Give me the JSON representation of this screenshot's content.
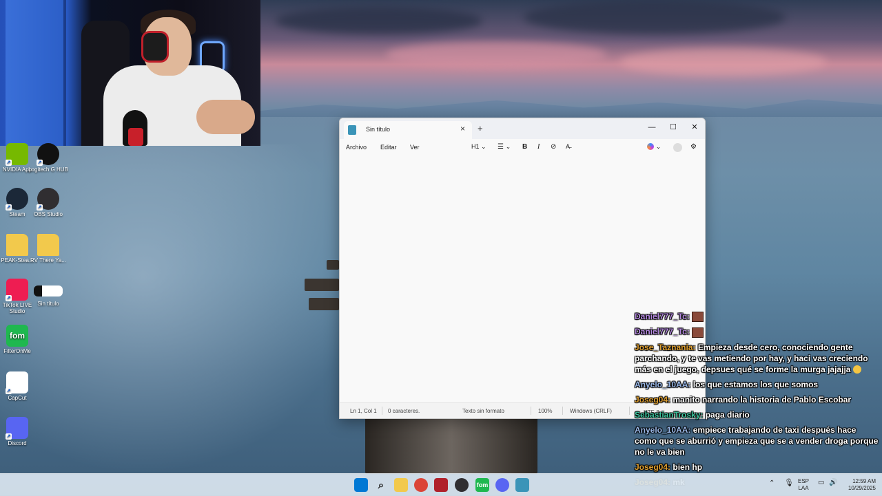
{
  "desktop": {
    "icons": [
      {
        "label": "NVIDIA App",
        "icon": "nvidia-icon",
        "color": "#76b900"
      },
      {
        "label": "Logitech G HUB",
        "icon": "logitech-g-icon",
        "color": "#111111"
      },
      {
        "label": "Steam",
        "icon": "steam-icon",
        "color": "#1b2838"
      },
      {
        "label": "OBS Studio",
        "icon": "obs-icon",
        "color": "#302e31"
      },
      {
        "label": "PEAK-Stea...",
        "icon": "folder-icon",
        "color": "#f2c94c"
      },
      {
        "label": "RV There Ya...",
        "icon": "folder-icon",
        "color": "#f2c94c"
      },
      {
        "label": "TikTok LIVE Studio",
        "icon": "tiktok-icon",
        "color": "#ee1d52"
      },
      {
        "label": "Sin título",
        "icon": "notepad-file-icon",
        "color": "#ffffff"
      },
      {
        "label": "FilterOnMe",
        "icon": "filteronme-icon",
        "color": "#1fb84f",
        "glyph": "fom"
      },
      {
        "label": "CapCut",
        "icon": "capcut-icon",
        "color": "#ffffff"
      },
      {
        "label": "Discord",
        "icon": "discord-icon",
        "color": "#5865f2"
      }
    ]
  },
  "notepad": {
    "tab_title": "Sin título",
    "close_tab": "×",
    "new_tab": "+",
    "window": {
      "minimize": "—",
      "maximize": "☐",
      "close": "✕"
    },
    "menu": {
      "file": "Archivo",
      "edit": "Editar",
      "view": "Ver"
    },
    "toolbar": {
      "heading": "H1",
      "bold": "B",
      "italic": "I"
    },
    "editor_text": "",
    "status": {
      "position": "Ln 1, Col 1",
      "chars": "0 caracteres.",
      "format": "Texto sin formato",
      "zoom": "100%",
      "line_ending": "Windows (CRLF)",
      "encoding": "UTF-8"
    }
  },
  "chat": [
    {
      "user": "Daniel777_Tc:",
      "color": "#b58ae0",
      "text": "",
      "emote": true
    },
    {
      "user": "Daniel777_Tc:",
      "color": "#b58ae0",
      "text": "",
      "emote": true
    },
    {
      "user": "Jose_Taznania:",
      "color": "#e0a030",
      "text": "Empieza desde cero, conociendo gente parchando, y te vas metiendo por hay, y haci vas creciendo más en el juego, depsues qué se forme la murga jajajja",
      "emoji": true
    },
    {
      "user": "Anyelo_10AA:",
      "color": "#9ab8e8",
      "text": "los que estamos los que somos"
    },
    {
      "user": "Joseg04:",
      "color": "#e0a030",
      "text": "manito narrando la historia de Pablo Escobar"
    },
    {
      "user": "SebastianTrosky:",
      "color": "#3ec8a0",
      "text": "paga diario"
    },
    {
      "user": "Anyelo_10AA:",
      "color": "#9ab8e8",
      "text": "empiece trabajando de taxi después hace como que se aburrió y empieza que se a vender droga porque no le va bien"
    },
    {
      "user": "Joseg04:",
      "color": "#e0a030",
      "text": "bien hp"
    },
    {
      "user": "Joseg04:",
      "color": "#e0a030",
      "text": "mk"
    }
  ],
  "taskbar": {
    "apps": [
      {
        "icon": "windows-start-icon",
        "color": "#0078d4"
      },
      {
        "icon": "search-icon",
        "color": "#333333"
      },
      {
        "icon": "file-explorer-icon",
        "color": "#f2c94c"
      },
      {
        "icon": "chrome-icon",
        "color": "#db4437"
      },
      {
        "icon": "video-editor-icon",
        "color": "#b0202a"
      },
      {
        "icon": "obs-icon",
        "color": "#302e31"
      },
      {
        "icon": "filteronme-icon",
        "color": "#1fb84f",
        "glyph": "fom"
      },
      {
        "icon": "discord-icon",
        "color": "#5865f2"
      },
      {
        "icon": "notepad-icon",
        "color": "#3a94b8"
      }
    ],
    "language": "ESP",
    "layout": "LAA",
    "time": "12:59 AM",
    "date": "10/29/2025"
  }
}
